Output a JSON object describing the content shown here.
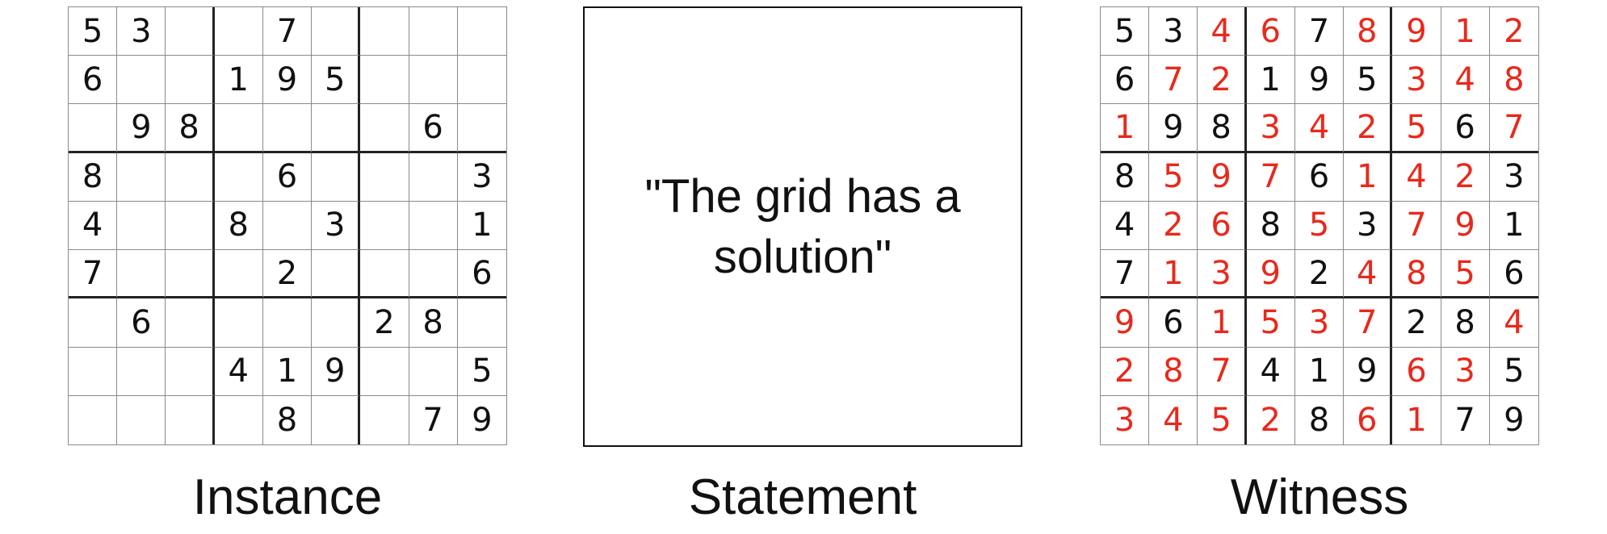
{
  "instance": {
    "caption": "Instance",
    "rows": [
      [
        "5",
        "3",
        "",
        "",
        "7",
        "",
        "",
        "",
        ""
      ],
      [
        "6",
        "",
        "",
        "1",
        "9",
        "5",
        "",
        "",
        ""
      ],
      [
        "",
        "9",
        "8",
        "",
        "",
        "",
        "",
        "6",
        ""
      ],
      [
        "8",
        "",
        "",
        "",
        "6",
        "",
        "",
        "",
        "3"
      ],
      [
        "4",
        "",
        "",
        "8",
        "",
        "3",
        "",
        "",
        "1"
      ],
      [
        "7",
        "",
        "",
        "",
        "2",
        "",
        "",
        "",
        "6"
      ],
      [
        "",
        "6",
        "",
        "",
        "",
        "",
        "2",
        "8",
        ""
      ],
      [
        "",
        "",
        "",
        "4",
        "1",
        "9",
        "",
        "",
        "5"
      ],
      [
        "",
        "",
        "",
        "",
        "8",
        "",
        "",
        "7",
        "9"
      ]
    ]
  },
  "statement": {
    "caption": "Statement",
    "text": "\"The grid has a solution\""
  },
  "witness": {
    "caption": "Witness",
    "rows": [
      [
        "5",
        "3",
        "4",
        "6",
        "7",
        "8",
        "9",
        "1",
        "2"
      ],
      [
        "6",
        "7",
        "2",
        "1",
        "9",
        "5",
        "3",
        "4",
        "8"
      ],
      [
        "1",
        "9",
        "8",
        "3",
        "4",
        "2",
        "5",
        "6",
        "7"
      ],
      [
        "8",
        "5",
        "9",
        "7",
        "6",
        "1",
        "4",
        "2",
        "3"
      ],
      [
        "4",
        "2",
        "6",
        "8",
        "5",
        "3",
        "7",
        "9",
        "1"
      ],
      [
        "7",
        "1",
        "3",
        "9",
        "2",
        "4",
        "8",
        "5",
        "6"
      ],
      [
        "9",
        "6",
        "1",
        "5",
        "3",
        "7",
        "2",
        "8",
        "4"
      ],
      [
        "2",
        "8",
        "7",
        "4",
        "1",
        "9",
        "6",
        "3",
        "5"
      ],
      [
        "3",
        "4",
        "5",
        "2",
        "8",
        "6",
        "1",
        "7",
        "9"
      ]
    ],
    "given_color": "#111111",
    "filled_color": "#e8291c"
  }
}
